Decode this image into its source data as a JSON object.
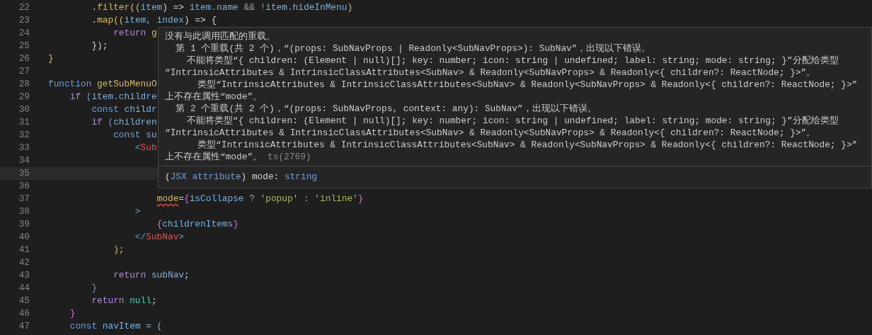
{
  "editor": {
    "lines": [
      {
        "number": "22",
        "current": false,
        "tokens": [
          {
            "text": "        .",
            "kind": "punct"
          },
          {
            "text": "filter",
            "kind": "func"
          },
          {
            "text": "((",
            "kind": "bracket"
          },
          {
            "text": "item",
            "kind": "ident"
          },
          {
            "text": ") => ",
            "kind": "punct"
          },
          {
            "text": "item.name",
            "kind": "ident"
          },
          {
            "text": " && !",
            "kind": "op"
          },
          {
            "text": "item.hideInMenu",
            "kind": "ident"
          },
          {
            "text": ")",
            "kind": "bracket"
          }
        ]
      },
      {
        "number": "23",
        "current": false,
        "tokens": [
          {
            "text": "        .",
            "kind": "punct"
          },
          {
            "text": "map",
            "kind": "func"
          },
          {
            "text": "((",
            "kind": "bracket"
          },
          {
            "text": "item, index",
            "kind": "ident"
          },
          {
            "text": ") => {",
            "kind": "punct"
          }
        ]
      },
      {
        "number": "24",
        "current": false,
        "tokens": [
          {
            "text": "            return",
            "kind": "control"
          },
          {
            "text": " g",
            "kind": "func"
          }
        ]
      },
      {
        "number": "25",
        "current": false,
        "tokens": [
          {
            "text": "        });",
            "kind": "punct"
          }
        ]
      },
      {
        "number": "26",
        "current": false,
        "tokens": [
          {
            "text": "}",
            "kind": "bracket"
          }
        ]
      },
      {
        "number": "27",
        "current": false
      },
      {
        "number": "28",
        "current": false,
        "tokens": [
          {
            "text": "function",
            "kind": "keyword"
          },
          {
            "text": " getSubMenuO",
            "kind": "func"
          }
        ]
      },
      {
        "number": "29",
        "current": false,
        "tokens": [
          {
            "text": "    if",
            "kind": "control"
          },
          {
            "text": " (",
            "kind": "tag-bracket"
          },
          {
            "text": "item.childre",
            "kind": "ident"
          }
        ]
      },
      {
        "number": "30",
        "current": false,
        "tokens": [
          {
            "text": "        const",
            "kind": "keyword"
          },
          {
            "text": " childr",
            "kind": "ident"
          }
        ]
      },
      {
        "number": "31",
        "current": false,
        "tokens": [
          {
            "text": "        if",
            "kind": "control"
          },
          {
            "text": " (",
            "kind": "tag-bracket"
          },
          {
            "text": "children",
            "kind": "ident"
          }
        ]
      },
      {
        "number": "32",
        "current": false,
        "tokens": [
          {
            "text": "            const",
            "kind": "keyword"
          },
          {
            "text": " su",
            "kind": "ident"
          }
        ]
      },
      {
        "number": "33",
        "current": false,
        "tokens": [
          {
            "text": "                <",
            "kind": "tag-bracket"
          },
          {
            "text": "Sub",
            "kind": "tag"
          }
        ]
      },
      {
        "number": "34",
        "current": false
      },
      {
        "number": "35",
        "current": true
      },
      {
        "number": "36",
        "current": false
      },
      {
        "number": "37",
        "current": false,
        "tokens": [
          {
            "text": "                    mode",
            "kind": "attr",
            "error": true
          },
          {
            "text": "=",
            "kind": "punct"
          },
          {
            "text": "{",
            "kind": "brace"
          },
          {
            "text": "isCollapse",
            "kind": "ident"
          },
          {
            "text": " ? ",
            "kind": "op"
          },
          {
            "text": "'popup'",
            "kind": "string"
          },
          {
            "text": " : ",
            "kind": "op"
          },
          {
            "text": "'inline'",
            "kind": "string"
          },
          {
            "text": "}",
            "kind": "brace"
          }
        ]
      },
      {
        "number": "38",
        "current": false,
        "tokens": [
          {
            "text": "                >",
            "kind": "tag-bracket"
          }
        ]
      },
      {
        "number": "39",
        "current": false,
        "tokens": [
          {
            "text": "                    {",
            "kind": "brace"
          },
          {
            "text": "childrenItems",
            "kind": "ident"
          },
          {
            "text": "}",
            "kind": "brace"
          }
        ]
      },
      {
        "number": "40",
        "current": false,
        "tokens": [
          {
            "text": "                </",
            "kind": "tag-bracket"
          },
          {
            "text": "SubNav",
            "kind": "tag"
          },
          {
            "text": ">",
            "kind": "tag-bracket"
          }
        ]
      },
      {
        "number": "41",
        "current": false,
        "tokens": [
          {
            "text": "            );",
            "kind": "bracket"
          }
        ]
      },
      {
        "number": "42",
        "current": false
      },
      {
        "number": "43",
        "current": false,
        "tokens": [
          {
            "text": "            return",
            "kind": "control"
          },
          {
            "text": " subNav",
            "kind": "ident"
          },
          {
            "text": ";",
            "kind": "punct"
          }
        ]
      },
      {
        "number": "44",
        "current": false,
        "tokens": [
          {
            "text": "        }",
            "kind": "tag-bracket"
          }
        ]
      },
      {
        "number": "45",
        "current": false,
        "tokens": [
          {
            "text": "        return",
            "kind": "control"
          },
          {
            "text": " null",
            "kind": "constant"
          },
          {
            "text": ";",
            "kind": "punct"
          }
        ]
      },
      {
        "number": "46",
        "current": false,
        "tokens": [
          {
            "text": "    }",
            "kind": "brace"
          }
        ]
      },
      {
        "number": "47",
        "current": false,
        "tokens": [
          {
            "text": "    const",
            "kind": "keyword"
          },
          {
            "text": " navItem = (",
            "kind": "ident"
          }
        ]
      }
    ]
  },
  "hover_tooltip": {
    "messages": [
      "没有与此调用匹配的重载。",
      "  第 1 个重载(共 2 个)，“(props: SubNavProps | Readonly<SubNavProps>): SubNav”，出现以下错误。",
      "    不能将类型“{ children: (Element | null)[]; key: number; icon: string | undefined; label: string; mode: string; }”分配给类型",
      "“IntrinsicAttributes & IntrinsicClassAttributes<SubNav> & Readonly<SubNavProps> & Readonly<{ children?: ReactNode; }>”。",
      "      类型“IntrinsicAttributes & IntrinsicClassAttributes<SubNav> & Readonly<SubNavProps> & Readonly<{ children?: ReactNode; }>”",
      "上不存在属性“mode”。",
      "  第 2 个重载(共 2 个)，“(props: SubNavProps, context: any): SubNav”，出现以下错误。",
      "    不能将类型“{ children: (Element | null)[]; key: number; icon: string | undefined; label: string; mode: string; }”分配给类型",
      "“IntrinsicAttributes & IntrinsicClassAttributes<SubNav> & Readonly<SubNavProps> & Readonly<{ children?: ReactNode; }>”。",
      "      类型“IntrinsicAttributes & IntrinsicClassAttributes<SubNav> & Readonly<SubNavProps> & Readonly<{ children?: ReactNode; }>”",
      "上不存在属性“mode”。"
    ],
    "error_code": "ts(2769)",
    "signature": [
      {
        "text": "(",
        "kind": "punct"
      },
      {
        "text": "JSX attribute",
        "kind": "keyword"
      },
      {
        "text": ") ",
        "kind": "punct"
      },
      {
        "text": "mode",
        "kind": "plain"
      },
      {
        "text": ": ",
        "kind": "punct"
      },
      {
        "text": "string",
        "kind": "keyword"
      }
    ]
  }
}
